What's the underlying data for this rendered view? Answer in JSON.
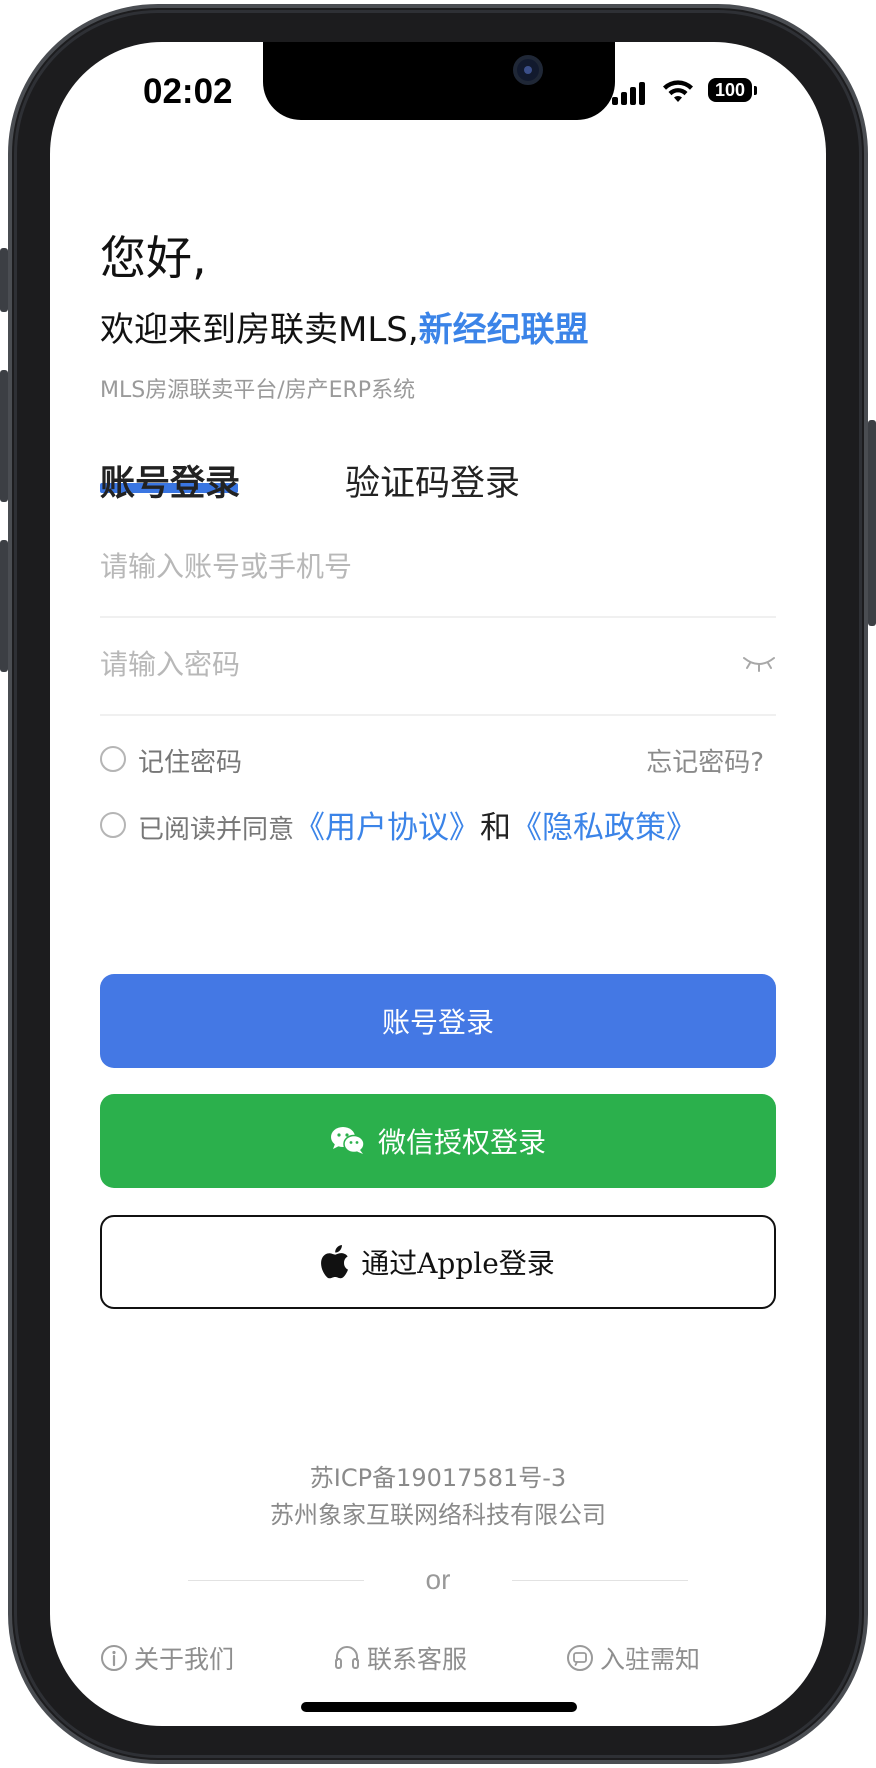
{
  "status_bar": {
    "time": "02:02",
    "battery": "100",
    "signal_icon": "cellular-signal-icon",
    "wifi_icon": "wifi-icon"
  },
  "header": {
    "greeting": "您好,",
    "welcome_prefix": "欢迎来到房联卖MLS,",
    "welcome_highlight": "新经纪联盟",
    "tagline": "MLS房源联卖平台/房产ERP系统"
  },
  "tabs": [
    {
      "label": "账号登录",
      "active": true
    },
    {
      "label": "验证码登录",
      "active": false
    }
  ],
  "form": {
    "account_placeholder": "请输入账号或手机号",
    "account_value": "",
    "password_placeholder": "请输入密码",
    "password_value": "",
    "remember_label": "记住密码",
    "forgot_label": "忘记密码?",
    "agree_prefix": "已阅读并同意",
    "user_agreement": "《用户协议》",
    "and": "和",
    "privacy_policy": "《隐私政策》"
  },
  "buttons": {
    "login": "账号登录",
    "wechat": "微信授权登录",
    "apple": "通过Apple登录"
  },
  "footer": {
    "icp": "苏ICP备19017581号-3",
    "company": "苏州象家互联网络科技有限公司",
    "or": "or",
    "links": [
      {
        "label": "关于我们",
        "icon": "info-icon"
      },
      {
        "label": "联系客服",
        "icon": "headset-icon"
      },
      {
        "label": "入驻需知",
        "icon": "chat-icon"
      }
    ]
  },
  "colors": {
    "accent_blue": "#4478e4",
    "link_blue": "#3b84e8",
    "wechat_green": "#2bb04c"
  }
}
